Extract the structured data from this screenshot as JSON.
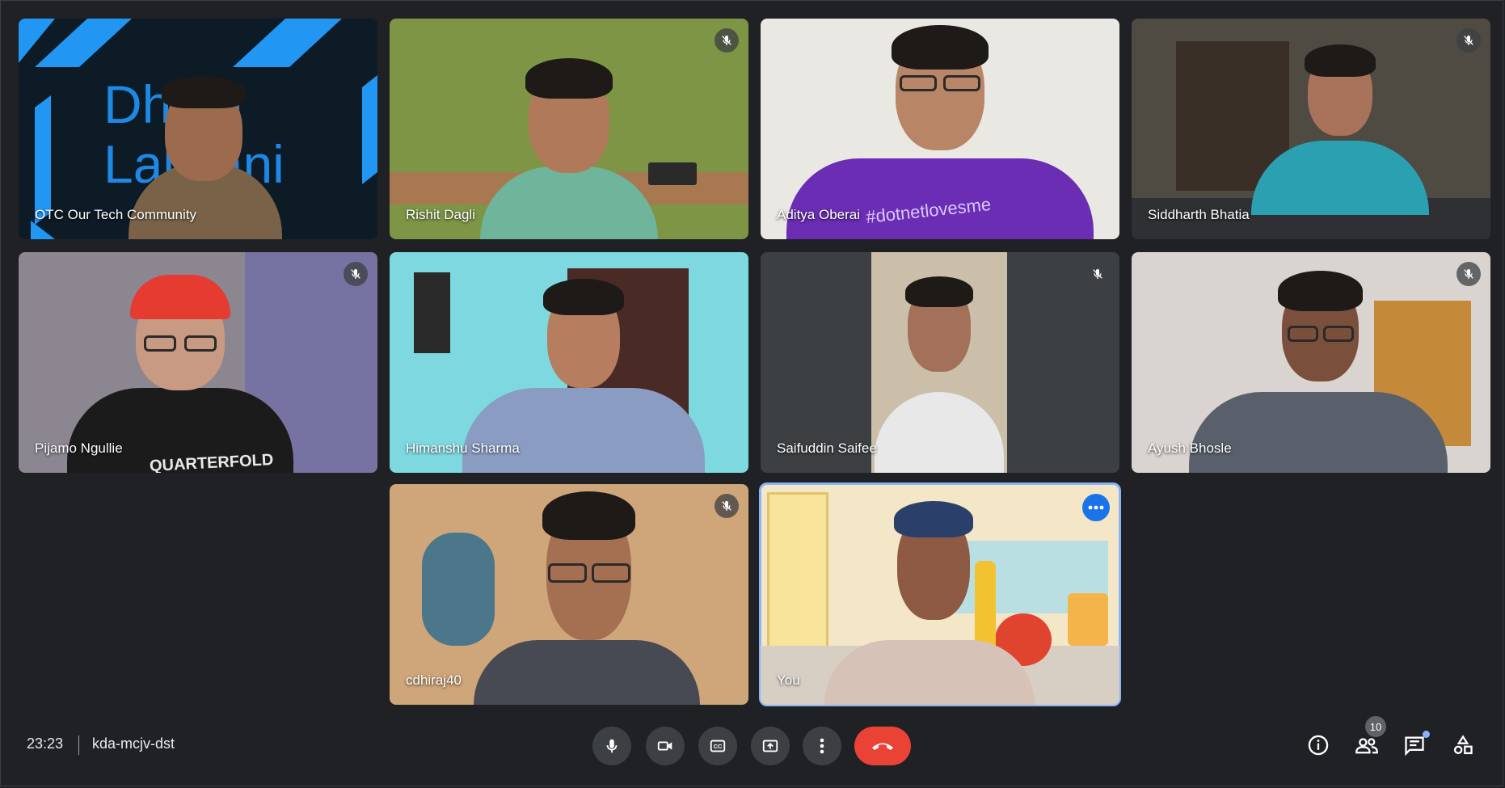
{
  "participants": [
    {
      "name": "OTC Our Tech Community",
      "muted": false,
      "background_text_line1": "Dhiraj",
      "background_text_line2": "Lalwani"
    },
    {
      "name": "Rishit Dagli",
      "muted": true
    },
    {
      "name": "Aditya Oberai",
      "muted": false,
      "shirt_text": "#dotnetlovesme"
    },
    {
      "name": "Siddharth Bhatia",
      "muted": true
    },
    {
      "name": "Pijamo Ngullie",
      "muted": true,
      "shirt_text": "QUARTERFOLD"
    },
    {
      "name": "Himanshu Sharma",
      "muted": false
    },
    {
      "name": "Saifuddin Saifee",
      "muted": true
    },
    {
      "name": "Ayush Bhosle",
      "muted": true
    },
    {
      "name": "cdhiraj40",
      "muted": true
    },
    {
      "name": "You",
      "muted": false,
      "self": true
    }
  ],
  "meeting": {
    "time": "23:23",
    "code": "kda-mcjv-dst"
  },
  "people_count": "10",
  "icons": {
    "mic": "mic-icon",
    "camera": "videocam-icon",
    "captions": "closed-captions-icon",
    "present": "present-screen-icon",
    "more": "more-vert-icon",
    "end_call": "call-end-icon",
    "info": "info-icon",
    "people": "people-icon",
    "chat": "chat-icon",
    "activities": "activities-icon"
  },
  "colors": {
    "background": "#202124",
    "end_call": "#ea4335",
    "accent": "#1a73e8",
    "self_outline": "#8ab4f8"
  }
}
